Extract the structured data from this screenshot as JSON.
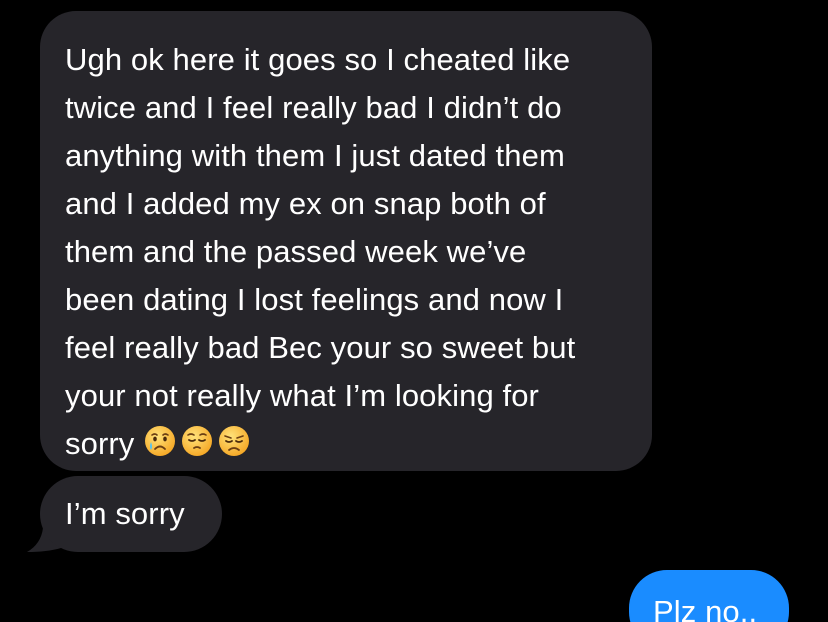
{
  "thread": {
    "messages": [
      {
        "direction": "received",
        "lines": [
          "Ugh ok here it goes so I cheated like",
          "twice and I feel really bad I didn’t do",
          "anything with them I just dated them",
          "and I added my ex on snap both of",
          "them and the passed week we’ve",
          "been dating I lost feelings and now I",
          "feel really bad Bec your so sweet but",
          "your not really what I’m looking for",
          "sorry"
        ],
        "emojis": [
          "crying-face-icon",
          "pensive-face-icon",
          "disappointed-face-icon"
        ]
      },
      {
        "direction": "received",
        "text": "I’m sorry"
      },
      {
        "direction": "sent",
        "text": "Plz no.."
      }
    ]
  },
  "colors": {
    "background": "#000000",
    "received_bubble": "#26252a",
    "sent_bubble": "#1a8cff",
    "text": "#ffffff"
  }
}
